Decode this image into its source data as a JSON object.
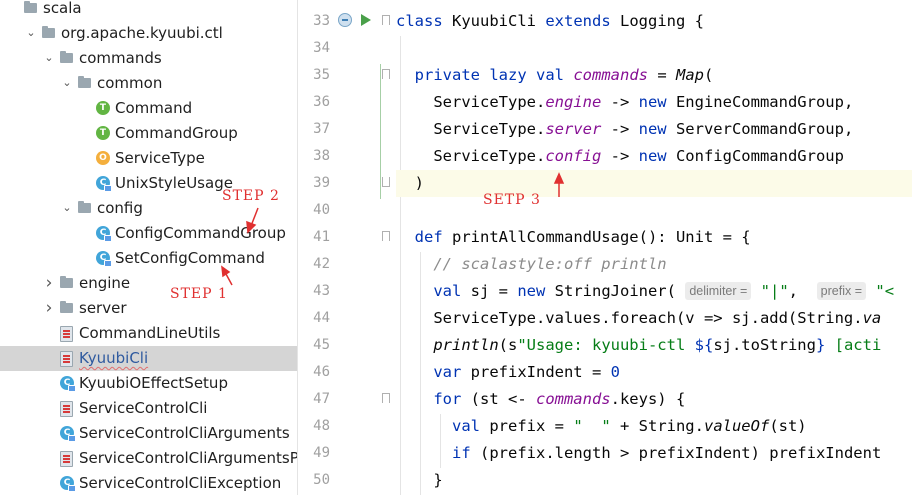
{
  "tree": [
    {
      "label": "scala",
      "icon": "folder-icon",
      "chevron": ""
    },
    {
      "label": "org.apache.kyuubi.ctl",
      "icon": "folder-icon",
      "chevron": "down"
    },
    {
      "label": "commands",
      "icon": "folder-icon",
      "chevron": "down"
    },
    {
      "label": "common",
      "icon": "folder-icon",
      "chevron": "down"
    },
    {
      "label": "Command",
      "icon": "trait-icon",
      "chevron": ""
    },
    {
      "label": "CommandGroup",
      "icon": "trait-icon",
      "chevron": ""
    },
    {
      "label": "ServiceType",
      "icon": "object-icon",
      "chevron": ""
    },
    {
      "label": "UnixStyleUsage",
      "icon": "class-icon",
      "chevron": ""
    },
    {
      "label": "config",
      "icon": "folder-icon",
      "chevron": "down"
    },
    {
      "label": "ConfigCommandGroup",
      "icon": "class-icon",
      "chevron": ""
    },
    {
      "label": "SetConfigCommand",
      "icon": "class-icon",
      "chevron": ""
    },
    {
      "label": "engine",
      "icon": "folder-icon",
      "chevron": "right"
    },
    {
      "label": "server",
      "icon": "folder-icon",
      "chevron": "right"
    },
    {
      "label": "CommandLineUtils",
      "icon": "scala-file-icon",
      "chevron": ""
    },
    {
      "label": "KyuubiCli",
      "icon": "scala-file-icon",
      "chevron": "",
      "selected": true
    },
    {
      "label": "KyuubiOEffectSetup",
      "icon": "class-icon",
      "chevron": ""
    },
    {
      "label": "ServiceControlCli",
      "icon": "scala-file-icon",
      "chevron": ""
    },
    {
      "label": "ServiceControlCliArguments",
      "icon": "class-icon",
      "chevron": ""
    },
    {
      "label": "ServiceControlCliArgumentsParser",
      "icon": "scala-file-icon",
      "chevron": ""
    },
    {
      "label": "ServiceControlCliException",
      "icon": "class-icon",
      "chevron": ""
    }
  ],
  "editor": {
    "line_numbers": [
      "33",
      "34",
      "35",
      "36",
      "37",
      "38",
      "39",
      "40",
      "41",
      "42",
      "43",
      "44",
      "45",
      "46",
      "47",
      "48",
      "49",
      "50"
    ],
    "hints": {
      "delimiter": "delimiter =",
      "prefix": "prefix ="
    }
  },
  "annotations": {
    "step1": "STEP 1",
    "step2": "STEP 2",
    "step3": "SETP 3"
  },
  "colors": {
    "annotation": "#e03030",
    "keyword": "#0033b3",
    "field": "#871094",
    "string": "#067d17",
    "selection": "#d5d5d5"
  }
}
